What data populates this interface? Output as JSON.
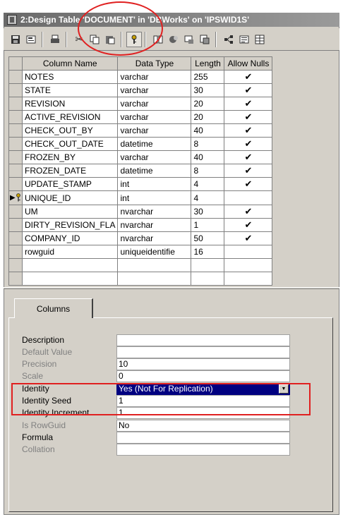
{
  "window": {
    "title": "2:Design Table 'DOCUMENT' in 'DBWorks' on 'IPSWID1S'"
  },
  "toolbar": {
    "icons": [
      "save-icon",
      "properties-icon",
      "print-icon",
      "cut-icon",
      "copy-icon",
      "paste-icon",
      "primary-key-icon",
      "relationships-icon",
      "indexes-icon",
      "constraints-icon",
      "triggers-icon",
      "permissions-icon",
      "script-icon",
      "generate-icon"
    ]
  },
  "grid": {
    "headers": [
      "Column Name",
      "Data Type",
      "Length",
      "Allow Nulls"
    ],
    "check_glyph": "✔",
    "rows": [
      {
        "name": "NOTES",
        "type": "varchar",
        "length": "255",
        "nulls": "✔"
      },
      {
        "name": "STATE",
        "type": "varchar",
        "length": "30",
        "nulls": "✔"
      },
      {
        "name": "REVISION",
        "type": "varchar",
        "length": "20",
        "nulls": "✔"
      },
      {
        "name": "ACTIVE_REVISION",
        "type": "varchar",
        "length": "20",
        "nulls": "✔"
      },
      {
        "name": "CHECK_OUT_BY",
        "type": "varchar",
        "length": "40",
        "nulls": "✔"
      },
      {
        "name": "CHECK_OUT_DATE",
        "type": "datetime",
        "length": "8",
        "nulls": "✔"
      },
      {
        "name": "FROZEN_BY",
        "type": "varchar",
        "length": "40",
        "nulls": "✔"
      },
      {
        "name": "FROZEN_DATE",
        "type": "datetime",
        "length": "8",
        "nulls": "✔"
      },
      {
        "name": "UPDATE_STAMP",
        "type": "int",
        "length": "4",
        "nulls": "✔"
      },
      {
        "name": "UNIQUE_ID",
        "type": "int",
        "length": "4",
        "nulls": ""
      },
      {
        "name": "UM",
        "type": "nvarchar",
        "length": "30",
        "nulls": "✔"
      },
      {
        "name": "DIRTY_REVISION_FLA",
        "type": "nvarchar",
        "length": "1",
        "nulls": "✔"
      },
      {
        "name": "COMPANY_ID",
        "type": "nvarchar",
        "length": "50",
        "nulls": "✔"
      },
      {
        "name": "rowguid",
        "type": "uniqueidentifie",
        "length": "16",
        "nulls": ""
      }
    ],
    "current_row_marker": "▶",
    "empty_rows": 2
  },
  "properties": {
    "tab_label": "Columns",
    "items": [
      {
        "label": "Description",
        "value": "",
        "dim": false
      },
      {
        "label": "Default Value",
        "value": "",
        "dim": true
      },
      {
        "label": "Precision",
        "value": "10",
        "dim": true
      },
      {
        "label": "Scale",
        "value": "0",
        "dim": true
      },
      {
        "label": "Identity",
        "value": "Yes (Not For Replication)",
        "dim": false,
        "dropdown": true
      },
      {
        "label": "Identity Seed",
        "value": "1",
        "dim": false
      },
      {
        "label": "Identity Increment",
        "value": "1",
        "dim": false
      },
      {
        "label": "Is RowGuid",
        "value": "No",
        "dim": true
      },
      {
        "label": "Formula",
        "value": "",
        "dim": false
      },
      {
        "label": "Collation",
        "value": "",
        "dim": true
      }
    ]
  },
  "annotation_color": "#e02020",
  "selection_color": "#000080"
}
